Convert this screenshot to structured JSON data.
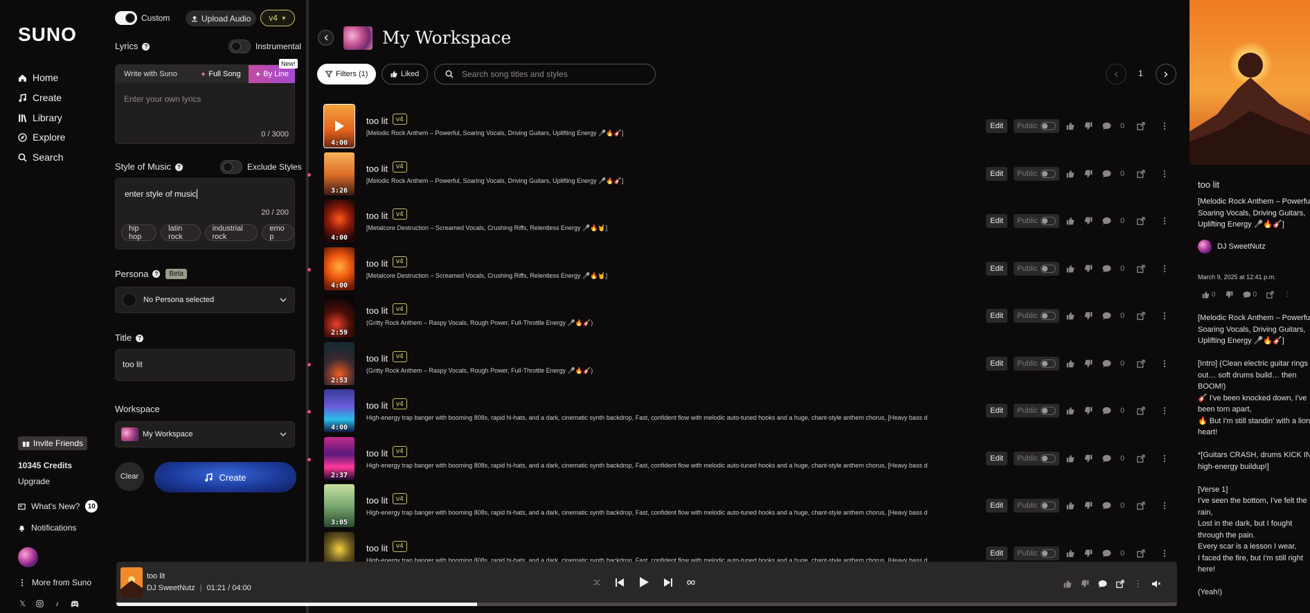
{
  "brand": "SUNO",
  "nav": {
    "items": [
      {
        "icon": "home-icon",
        "label": "Home"
      },
      {
        "icon": "create-icon",
        "label": "Create"
      },
      {
        "icon": "library-icon",
        "label": "Library"
      },
      {
        "icon": "explore-icon",
        "label": "Explore"
      },
      {
        "icon": "search-icon",
        "label": "Search"
      }
    ],
    "invite_label": "Invite Friends",
    "credits": "10345 Credits",
    "upgrade": "Upgrade",
    "whats_new": "What's New?",
    "whats_new_count": "10",
    "notifications": "Notifications",
    "more_from": "More from Suno"
  },
  "create": {
    "custom_label": "Custom",
    "upload_label": "Upload Audio",
    "model": "v4",
    "lyrics_label": "Lyrics",
    "instrumental_label": "Instrumental",
    "write_with": "Write with Suno",
    "full_song": "Full Song",
    "by_line": "By Line",
    "new_badge": "New!",
    "lyrics_placeholder": "Enter your own lyrics",
    "lyrics_count": "0 / 3000",
    "style_label": "Style of Music",
    "exclude_label": "Exclude Styles",
    "style_value": "enter style of music",
    "style_count": "20 / 200",
    "style_tags": [
      "hip hop",
      "latin rock",
      "industrial rock",
      "emo p"
    ],
    "persona_label": "Persona",
    "beta": "Beta",
    "persona_value": "No Persona selected",
    "title_label": "Title",
    "title_value": "too lit",
    "workspace_label": "Workspace",
    "workspace_value": "My Workspace",
    "clear": "Clear",
    "create_btn": "Create"
  },
  "main": {
    "title": "My Workspace",
    "filters": "Filters (1)",
    "liked": "Liked",
    "search_placeholder": "Search song titles and styles",
    "page": "1",
    "edit": "Edit",
    "public": "Public",
    "comment_count": "0",
    "songs": [
      {
        "title": "too lit",
        "tag": "v4",
        "duration": "4:00",
        "desc": "[Melodic Rock Anthem – Powerful, Soaring Vocals, Driving Guitars, Uplifting Energy 🎤🔥🎸]",
        "dot": false,
        "theme": "sunset",
        "playing": true
      },
      {
        "title": "too lit",
        "tag": "v4",
        "duration": "3:26",
        "desc": "[Melodic Rock Anthem – Powerful, Soaring Vocals, Driving Guitars, Uplifting Energy 🎤🔥🎸]",
        "dot": true,
        "theme": "mountain",
        "playing": false
      },
      {
        "title": "too lit",
        "tag": "v4",
        "duration": "4:00",
        "desc": "[Metalcore Destruction – Screamed Vocals, Crushing Riffs, Relentless Energy 🎤🔥🤘]",
        "dot": false,
        "theme": "phoenix-dark",
        "playing": false
      },
      {
        "title": "too lit",
        "tag": "v4",
        "duration": "4:00",
        "desc": "[Metalcore Destruction – Screamed Vocals, Crushing Riffs, Relentless Energy 🎤🔥🤘]",
        "dot": true,
        "theme": "phoenix",
        "playing": false
      },
      {
        "title": "too lit",
        "tag": "v4",
        "duration": "2:59",
        "desc": "(Gritty Rock Anthem – Raspy Vocals, Rough Power, Full-Throttle Energy 🎤🔥🎸)",
        "dot": false,
        "theme": "fire-dark",
        "playing": false
      },
      {
        "title": "too lit",
        "tag": "v4",
        "duration": "2:53",
        "desc": "(Gritty Rock Anthem – Raspy Vocals, Rough Power, Full-Throttle Energy 🎤🔥🎸)",
        "dot": true,
        "theme": "rider",
        "playing": false
      },
      {
        "title": "too lit",
        "tag": "v4",
        "duration": "4:00",
        "desc": "High-energy trap banger with booming 808s, rapid hi-hats, and a dark, cinematic synth backdrop, Fast, confident flow with melodic auto-tuned hooks and a huge, chant-style anthem chorus, [Heavy bass d",
        "dot": true,
        "theme": "car-blue",
        "playing": false
      },
      {
        "title": "too lit",
        "tag": "v4",
        "duration": "2:37",
        "desc": "High-energy trap banger with booming 808s, rapid hi-hats, and a dark, cinematic synth backdrop, Fast, confident flow with melodic auto-tuned hooks and a huge, chant-style anthem chorus, [Heavy bass d",
        "dot": true,
        "theme": "neon",
        "playing": false
      },
      {
        "title": "too lit",
        "tag": "v4",
        "duration": "3:05",
        "desc": "High-energy trap banger with booming 808s, rapid hi-hats, and a dark, cinematic synth backdrop, Fast, confident flow with melodic auto-tuned hooks and a huge, chant-style anthem chorus, [Heavy bass d",
        "dot": false,
        "theme": "green",
        "playing": false
      },
      {
        "title": "too lit",
        "tag": "v4",
        "duration": "",
        "desc": "High-energy trap banger with booming 808s, rapid hi-hats, and a dark, cinematic synth backdrop, Fast, confident flow with melodic auto-tuned hooks and a huge, chant-style anthem chorus, [Heavy bass d",
        "dot": false,
        "theme": "street",
        "playing": false
      }
    ]
  },
  "detail": {
    "title": "too lit",
    "style": "[Melodic Rock Anthem – Powerful Soaring Vocals, Driving Guitars, Uplifting Energy 🎤🔥🎸]",
    "artist": "DJ SweetNutz",
    "date": "March 9, 2025 at 12:41 p.m.",
    "likes": "0",
    "comments": "0",
    "lyrics": "[Melodic Rock Anthem – Powerful Soaring Vocals, Driving Guitars, Uplifting Energy 🎤🔥🎸]\n\n[Intro] (Clean electric guitar rings out… soft drums build… then BOOM!)\n🎸 I've been knocked down, I've been torn apart,\n🔥 But I'm still standin' with a lion's heart!\n\n*[Guitars CRASH, drums KICK IN– high-energy buildup!]\n\n[Verse 1]\nI've seen the bottom, I've felt the rain,\nLost in the dark, but I fought through the pain.\nEvery scar is a lesson I wear,\nI faced the fire, but I'm still right here!\n\n(Yeah!)"
  },
  "player": {
    "title": "too lit",
    "artist": "DJ SweetNutz",
    "time": "01:21 / 04:00",
    "progress": 0.34
  }
}
